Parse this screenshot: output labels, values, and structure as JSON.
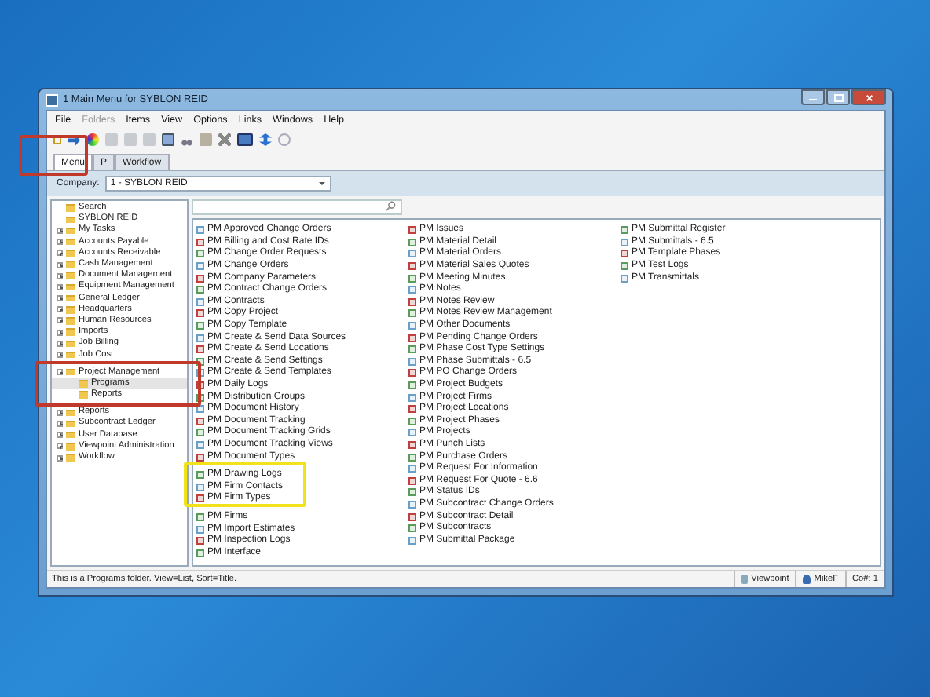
{
  "window": {
    "title": "1 Main Menu for SYBLON REID"
  },
  "menu": [
    {
      "label": "File",
      "disabled": false
    },
    {
      "label": "Folders",
      "disabled": true
    },
    {
      "label": "Items",
      "disabled": false
    },
    {
      "label": "View",
      "disabled": false
    },
    {
      "label": "Options",
      "disabled": false
    },
    {
      "label": "Links",
      "disabled": false
    },
    {
      "label": "Windows",
      "disabled": false
    },
    {
      "label": "Help",
      "disabled": false
    }
  ],
  "tabs": [
    {
      "label": "Menu",
      "selected": true
    },
    {
      "label": "P",
      "selected": false
    },
    {
      "label": "Workflow",
      "selected": false
    }
  ],
  "company": {
    "label": "Company:",
    "value": "1 - SYBLON REID"
  },
  "tree": [
    {
      "label": "Search",
      "kind": "plain",
      "selected": false
    },
    {
      "label": "SYBLON REID",
      "kind": "plain",
      "selected": false
    },
    {
      "label": "My Tasks",
      "kind": "group",
      "expanded": false,
      "selected": false
    },
    {
      "label": "Accounts Payable",
      "kind": "group",
      "expanded": false,
      "selected": false
    },
    {
      "label": "Accounts Receivable",
      "kind": "group",
      "expanded": false,
      "selected": false
    },
    {
      "label": "Cash Management",
      "kind": "group",
      "expanded": false,
      "selected": false
    },
    {
      "label": "Document Management",
      "kind": "group",
      "expanded": false,
      "selected": false
    },
    {
      "label": "Equipment Management",
      "kind": "group",
      "expanded": false,
      "selected": false
    },
    {
      "label": "General Ledger",
      "kind": "group",
      "expanded": false,
      "selected": false
    },
    {
      "label": "Headquarters",
      "kind": "group",
      "expanded": false,
      "selected": false
    },
    {
      "label": "Human Resources",
      "kind": "group",
      "expanded": false,
      "selected": false
    },
    {
      "label": "Imports",
      "kind": "group",
      "expanded": false,
      "selected": false
    },
    {
      "label": "Job Billing",
      "kind": "group",
      "expanded": false,
      "selected": false
    },
    {
      "label": "Job Cost",
      "kind": "group",
      "expanded": false,
      "selected": false
    },
    {
      "label": "Project Management",
      "kind": "group",
      "expanded": true,
      "selected": false,
      "children": [
        {
          "label": "Programs",
          "selected": true
        },
        {
          "label": "Reports",
          "selected": false
        }
      ]
    },
    {
      "label": "Reports",
      "kind": "group",
      "expanded": false,
      "selected": false
    },
    {
      "label": "Subcontract Ledger",
      "kind": "group",
      "expanded": false,
      "selected": false
    },
    {
      "label": "User Database",
      "kind": "group",
      "expanded": false,
      "selected": false
    },
    {
      "label": "Viewpoint Administration",
      "kind": "group",
      "expanded": false,
      "selected": false
    },
    {
      "label": "Workflow",
      "kind": "group",
      "expanded": false,
      "selected": false
    }
  ],
  "programs": {
    "columns": [
      [
        "PM Approved Change Orders",
        "PM Billing and Cost Rate IDs",
        "PM Change Order Requests",
        "PM Change Orders",
        "PM Company Parameters",
        "PM Contract Change Orders",
        "PM Contracts",
        "PM Copy Project",
        "PM Copy Template",
        "PM Create & Send Data Sources",
        "PM Create & Send Locations",
        "PM Create & Send Settings",
        "PM Create & Send Templates",
        "PM Daily Logs",
        "PM Distribution Groups",
        "PM Document History",
        "PM Document Tracking",
        "PM Document Tracking Grids",
        "PM Document Tracking Views",
        "PM Document Types",
        "PM Drawing Logs",
        "PM Firm Contacts",
        "PM Firm Types",
        "PM Firms",
        "PM Import Estimates",
        "PM Inspection Logs",
        "PM Interface"
      ],
      [
        "PM Issues",
        "PM Material Detail",
        "PM Material Orders",
        "PM Material Sales Quotes",
        "PM Meeting Minutes",
        "PM Notes",
        "PM Notes Review",
        "PM Notes Review Management",
        "PM Other Documents",
        "PM Pending Change Orders",
        "PM Phase Cost Type Settings",
        "PM Phase Submittals - 6.5",
        "PM PO Change Orders",
        "PM Project Budgets",
        "PM Project Firms",
        "PM Project Locations",
        "PM Project Phases",
        "PM Projects",
        "PM Punch Lists",
        "PM Purchase Orders",
        "PM Request For Information",
        "PM Request For Quote - 6.6",
        "PM Status IDs",
        "PM Subcontract Change Orders",
        "PM Subcontract Detail",
        "PM Subcontracts",
        "PM Submittal Package"
      ],
      [
        "PM Submittal Register",
        "PM Submittals - 6.5",
        "PM Template Phases",
        "PM Test Logs",
        "PM Transmittals"
      ]
    ]
  },
  "status_bar": {
    "message": "This is a Programs folder. View=List, Sort=Title.",
    "server": "Viewpoint",
    "user": "MikeF",
    "company": "Co#: 1"
  },
  "annotations": [
    {
      "color": "#c0392b"
    },
    {
      "color": "#c0392b"
    },
    {
      "color": "#f2e21a"
    }
  ]
}
